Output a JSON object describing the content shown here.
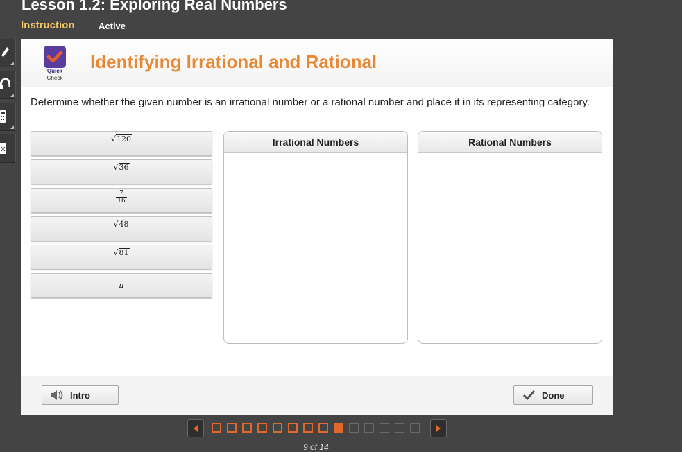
{
  "lesson": {
    "title": "Lesson 1.2: Exploring Real Numbers",
    "tab_name": "Instruction",
    "status": "Active"
  },
  "toolbar": {
    "tools": [
      "pencil-icon",
      "headphones-icon",
      "calculator-icon",
      "formula-icon"
    ]
  },
  "activity": {
    "badge_label_line1": "Quick",
    "badge_label_line2": "Check",
    "title": "Identifying Irrational and Rational",
    "instructions": "Determine whether the given number is an irrational number or a rational number and place it in its representing category."
  },
  "tiles": [
    {
      "type": "sqrt",
      "radicand": "120"
    },
    {
      "type": "sqrt",
      "radicand": "36"
    },
    {
      "type": "frac",
      "numerator": "7",
      "denominator": "16"
    },
    {
      "type": "sqrt",
      "radicand": "48"
    },
    {
      "type": "sqrt",
      "radicand": "81"
    },
    {
      "type": "symbol",
      "text": "π"
    }
  ],
  "bins": {
    "irrational_label": "Irrational Numbers",
    "rational_label": "Rational Numbers"
  },
  "footer": {
    "intro_label": "Intro",
    "done_label": "Done"
  },
  "pager": {
    "current": 9,
    "total": 14,
    "text": "9 of 14"
  },
  "colors": {
    "accent": "#e88833",
    "pager_accent": "#e1672a",
    "tab_name": "#f6c76a",
    "badge": "#5a3c9e",
    "background": "#444444"
  }
}
